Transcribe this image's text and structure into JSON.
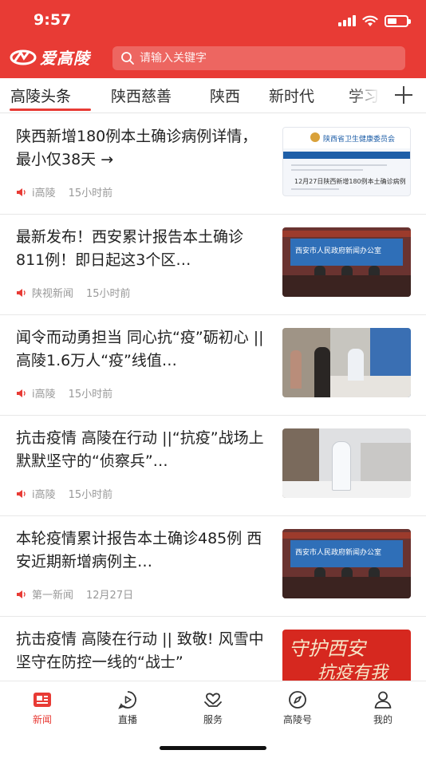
{
  "status_bar": {
    "time": "9:57"
  },
  "header": {
    "logo_text": "爱高陵",
    "search_placeholder": "请输入关键字"
  },
  "tabs": [
    {
      "label": "高陵头条",
      "active": true
    },
    {
      "label": "陕西慈善"
    },
    {
      "label": "陕西"
    },
    {
      "label": "新时代"
    },
    {
      "label": "学习"
    }
  ],
  "news": [
    {
      "title": "陕西新增180例本土确诊病例详情，最小仅38天 →",
      "source": "i高陵",
      "time": "15小时前",
      "thumb_text": [
        "陕西省卫生健康委员会",
        "12月27日陕西新增180例本土确诊病例"
      ]
    },
    {
      "title": "最新发布！西安累计报告本土确诊811例！即日起这3个区…",
      "source": "陕视新闻",
      "time": "15小时前",
      "thumb_text": [
        "西安市人民政府新闻办公室"
      ]
    },
    {
      "title": "闻令而动勇担当 同心抗“疫”砺初心 || 高陵1.6万人“疫”线值…",
      "source": "i高陵",
      "time": "15小时前"
    },
    {
      "title": "抗击疫情 高陵在行动 ||“抗疫”战场上默默坚守的“侦察兵”…",
      "source": "i高陵",
      "time": "15小时前"
    },
    {
      "title": "本轮疫情累计报告本土确诊485例 西安近期新增病例主…",
      "source": "第一新闻",
      "time": "12月27日",
      "thumb_text": [
        "西安市人民政府新闻办公室"
      ]
    },
    {
      "title": "抗击疫情 高陵在行动 || 致敬! 风雪中坚守在防控一线的“战士”",
      "thumb_text": [
        "守护西安",
        "抗疫有我"
      ]
    }
  ],
  "bottom_nav": [
    {
      "label": "新闻",
      "icon": "news-icon",
      "active": true
    },
    {
      "label": "直播",
      "icon": "live-icon"
    },
    {
      "label": "服务",
      "icon": "service-icon"
    },
    {
      "label": "高陵号",
      "icon": "compass-icon"
    },
    {
      "label": "我的",
      "icon": "profile-icon"
    }
  ],
  "colors": {
    "brand": "#e83b35"
  }
}
